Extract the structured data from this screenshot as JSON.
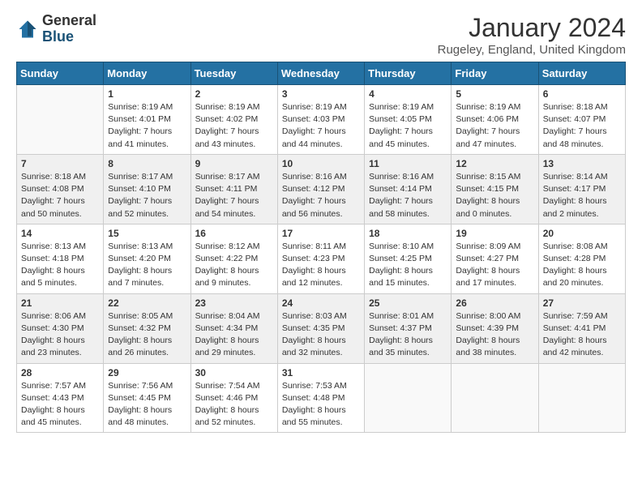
{
  "header": {
    "logo_general": "General",
    "logo_blue": "Blue",
    "month_year": "January 2024",
    "location": "Rugeley, England, United Kingdom"
  },
  "days_of_week": [
    "Sunday",
    "Monday",
    "Tuesday",
    "Wednesday",
    "Thursday",
    "Friday",
    "Saturday"
  ],
  "weeks": [
    [
      {
        "day": "",
        "sunrise": "",
        "sunset": "",
        "daylight": ""
      },
      {
        "day": "1",
        "sunrise": "Sunrise: 8:19 AM",
        "sunset": "Sunset: 4:01 PM",
        "daylight": "Daylight: 7 hours and 41 minutes."
      },
      {
        "day": "2",
        "sunrise": "Sunrise: 8:19 AM",
        "sunset": "Sunset: 4:02 PM",
        "daylight": "Daylight: 7 hours and 43 minutes."
      },
      {
        "day": "3",
        "sunrise": "Sunrise: 8:19 AM",
        "sunset": "Sunset: 4:03 PM",
        "daylight": "Daylight: 7 hours and 44 minutes."
      },
      {
        "day": "4",
        "sunrise": "Sunrise: 8:19 AM",
        "sunset": "Sunset: 4:05 PM",
        "daylight": "Daylight: 7 hours and 45 minutes."
      },
      {
        "day": "5",
        "sunrise": "Sunrise: 8:19 AM",
        "sunset": "Sunset: 4:06 PM",
        "daylight": "Daylight: 7 hours and 47 minutes."
      },
      {
        "day": "6",
        "sunrise": "Sunrise: 8:18 AM",
        "sunset": "Sunset: 4:07 PM",
        "daylight": "Daylight: 7 hours and 48 minutes."
      }
    ],
    [
      {
        "day": "7",
        "sunrise": "Sunrise: 8:18 AM",
        "sunset": "Sunset: 4:08 PM",
        "daylight": "Daylight: 7 hours and 50 minutes."
      },
      {
        "day": "8",
        "sunrise": "Sunrise: 8:17 AM",
        "sunset": "Sunset: 4:10 PM",
        "daylight": "Daylight: 7 hours and 52 minutes."
      },
      {
        "day": "9",
        "sunrise": "Sunrise: 8:17 AM",
        "sunset": "Sunset: 4:11 PM",
        "daylight": "Daylight: 7 hours and 54 minutes."
      },
      {
        "day": "10",
        "sunrise": "Sunrise: 8:16 AM",
        "sunset": "Sunset: 4:12 PM",
        "daylight": "Daylight: 7 hours and 56 minutes."
      },
      {
        "day": "11",
        "sunrise": "Sunrise: 8:16 AM",
        "sunset": "Sunset: 4:14 PM",
        "daylight": "Daylight: 7 hours and 58 minutes."
      },
      {
        "day": "12",
        "sunrise": "Sunrise: 8:15 AM",
        "sunset": "Sunset: 4:15 PM",
        "daylight": "Daylight: 8 hours and 0 minutes."
      },
      {
        "day": "13",
        "sunrise": "Sunrise: 8:14 AM",
        "sunset": "Sunset: 4:17 PM",
        "daylight": "Daylight: 8 hours and 2 minutes."
      }
    ],
    [
      {
        "day": "14",
        "sunrise": "Sunrise: 8:13 AM",
        "sunset": "Sunset: 4:18 PM",
        "daylight": "Daylight: 8 hours and 5 minutes."
      },
      {
        "day": "15",
        "sunrise": "Sunrise: 8:13 AM",
        "sunset": "Sunset: 4:20 PM",
        "daylight": "Daylight: 8 hours and 7 minutes."
      },
      {
        "day": "16",
        "sunrise": "Sunrise: 8:12 AM",
        "sunset": "Sunset: 4:22 PM",
        "daylight": "Daylight: 8 hours and 9 minutes."
      },
      {
        "day": "17",
        "sunrise": "Sunrise: 8:11 AM",
        "sunset": "Sunset: 4:23 PM",
        "daylight": "Daylight: 8 hours and 12 minutes."
      },
      {
        "day": "18",
        "sunrise": "Sunrise: 8:10 AM",
        "sunset": "Sunset: 4:25 PM",
        "daylight": "Daylight: 8 hours and 15 minutes."
      },
      {
        "day": "19",
        "sunrise": "Sunrise: 8:09 AM",
        "sunset": "Sunset: 4:27 PM",
        "daylight": "Daylight: 8 hours and 17 minutes."
      },
      {
        "day": "20",
        "sunrise": "Sunrise: 8:08 AM",
        "sunset": "Sunset: 4:28 PM",
        "daylight": "Daylight: 8 hours and 20 minutes."
      }
    ],
    [
      {
        "day": "21",
        "sunrise": "Sunrise: 8:06 AM",
        "sunset": "Sunset: 4:30 PM",
        "daylight": "Daylight: 8 hours and 23 minutes."
      },
      {
        "day": "22",
        "sunrise": "Sunrise: 8:05 AM",
        "sunset": "Sunset: 4:32 PM",
        "daylight": "Daylight: 8 hours and 26 minutes."
      },
      {
        "day": "23",
        "sunrise": "Sunrise: 8:04 AM",
        "sunset": "Sunset: 4:34 PM",
        "daylight": "Daylight: 8 hours and 29 minutes."
      },
      {
        "day": "24",
        "sunrise": "Sunrise: 8:03 AM",
        "sunset": "Sunset: 4:35 PM",
        "daylight": "Daylight: 8 hours and 32 minutes."
      },
      {
        "day": "25",
        "sunrise": "Sunrise: 8:01 AM",
        "sunset": "Sunset: 4:37 PM",
        "daylight": "Daylight: 8 hours and 35 minutes."
      },
      {
        "day": "26",
        "sunrise": "Sunrise: 8:00 AM",
        "sunset": "Sunset: 4:39 PM",
        "daylight": "Daylight: 8 hours and 38 minutes."
      },
      {
        "day": "27",
        "sunrise": "Sunrise: 7:59 AM",
        "sunset": "Sunset: 4:41 PM",
        "daylight": "Daylight: 8 hours and 42 minutes."
      }
    ],
    [
      {
        "day": "28",
        "sunrise": "Sunrise: 7:57 AM",
        "sunset": "Sunset: 4:43 PM",
        "daylight": "Daylight: 8 hours and 45 minutes."
      },
      {
        "day": "29",
        "sunrise": "Sunrise: 7:56 AM",
        "sunset": "Sunset: 4:45 PM",
        "daylight": "Daylight: 8 hours and 48 minutes."
      },
      {
        "day": "30",
        "sunrise": "Sunrise: 7:54 AM",
        "sunset": "Sunset: 4:46 PM",
        "daylight": "Daylight: 8 hours and 52 minutes."
      },
      {
        "day": "31",
        "sunrise": "Sunrise: 7:53 AM",
        "sunset": "Sunset: 4:48 PM",
        "daylight": "Daylight: 8 hours and 55 minutes."
      },
      {
        "day": "",
        "sunrise": "",
        "sunset": "",
        "daylight": ""
      },
      {
        "day": "",
        "sunrise": "",
        "sunset": "",
        "daylight": ""
      },
      {
        "day": "",
        "sunrise": "",
        "sunset": "",
        "daylight": ""
      }
    ]
  ]
}
